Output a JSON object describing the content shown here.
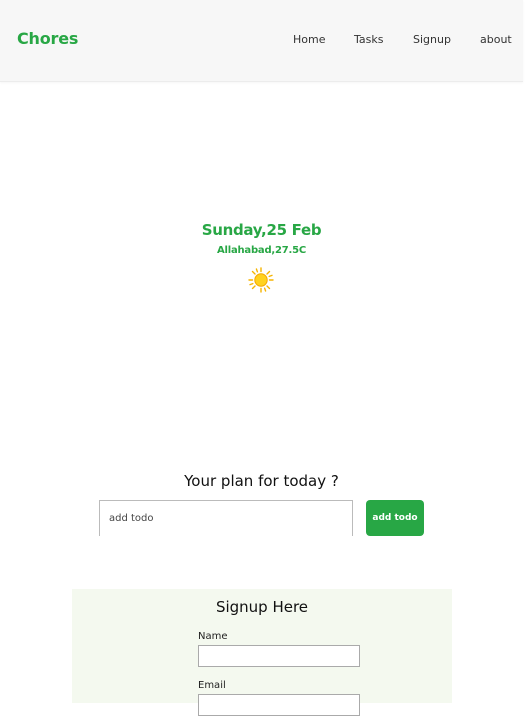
{
  "navbar": {
    "brand": "Chores",
    "links": [
      "Home",
      "Tasks",
      "Signup",
      "about"
    ]
  },
  "weather": {
    "date": "Sunday,25 Feb",
    "location": "Allahabad,27.5C",
    "icon": "sun-icon"
  },
  "todo": {
    "heading": "Your plan for today ?",
    "input_placeholder": "add todo",
    "input_value": "",
    "button_label": "add todo"
  },
  "signup": {
    "title": "Signup Here",
    "name_label": "Name",
    "name_value": "",
    "email_label": "Email",
    "email_value": ""
  },
  "colors": {
    "accent": "#28a745",
    "navbar_bg": "#f7f7f7",
    "signup_bg": "#f4f9ef"
  }
}
